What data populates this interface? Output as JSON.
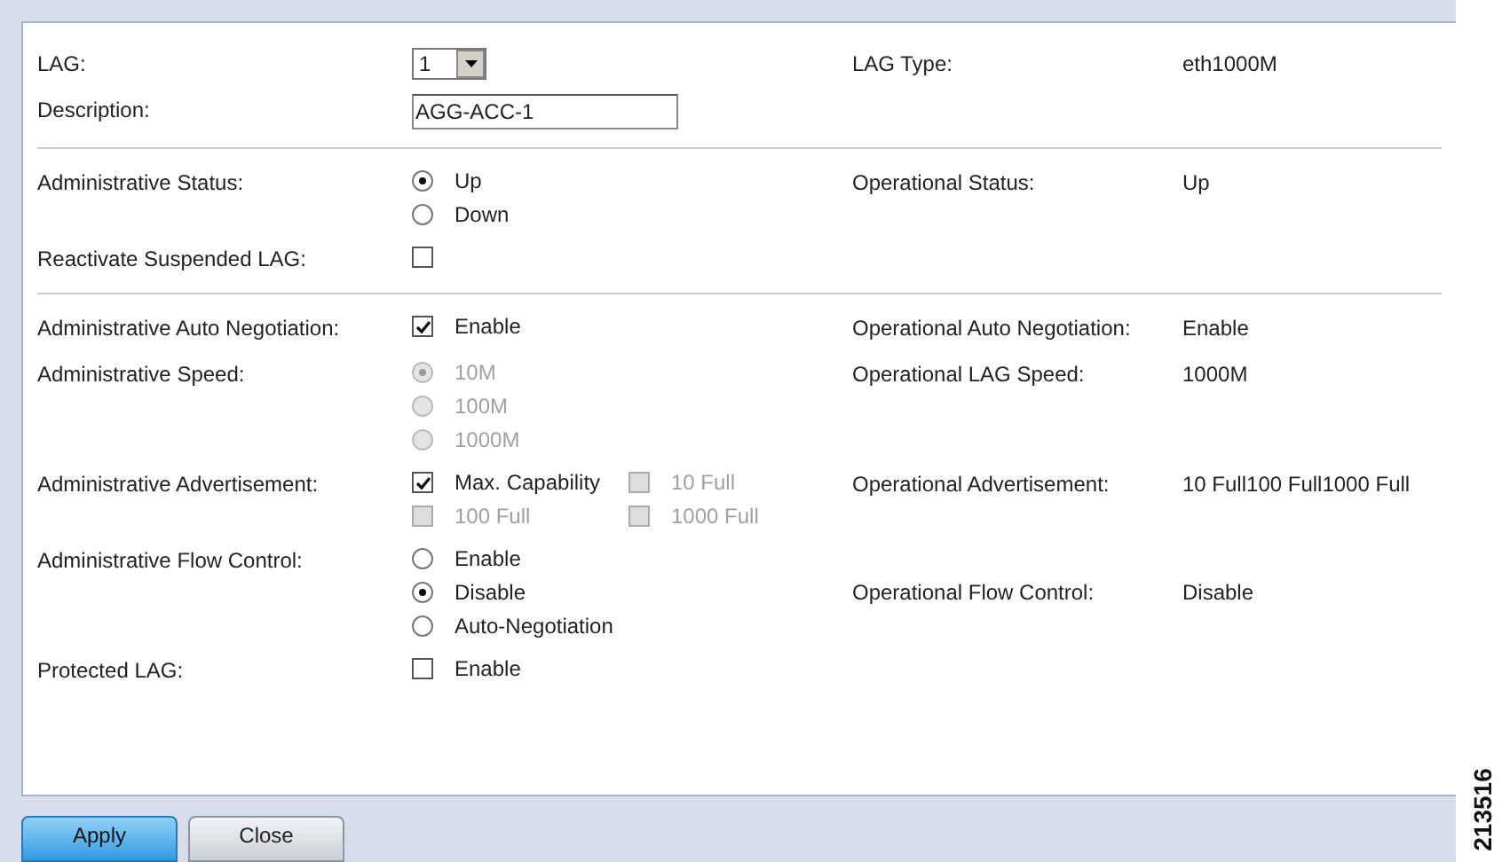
{
  "sections": [
    {
      "rows": [
        {
          "label": "LAG:",
          "control": {
            "kind": "select",
            "value": "1"
          },
          "op_label": "LAG Type:",
          "op_value": "eth1000M"
        },
        {
          "label": "Description:",
          "control": {
            "kind": "text",
            "value": "AGG-ACC-1"
          }
        }
      ]
    },
    {
      "rows": [
        {
          "label": "Administrative Status:",
          "control": {
            "kind": "radio",
            "options": [
              {
                "label": "Up",
                "selected": true,
                "disabled": false
              },
              {
                "label": "Down",
                "selected": false,
                "disabled": false
              }
            ]
          },
          "op_label": "Operational Status:",
          "op_value": "Up"
        },
        {
          "label": "Reactivate Suspended LAG:",
          "control": {
            "kind": "checkbox",
            "options": [
              {
                "checked": false,
                "disabled": false
              }
            ]
          }
        }
      ]
    },
    {
      "rows": [
        {
          "label": "Administrative Auto Negotiation:",
          "control": {
            "kind": "checkbox",
            "options": [
              {
                "label": "Enable",
                "checked": true,
                "disabled": false
              }
            ]
          },
          "op_label": "Operational Auto Negotiation:",
          "op_value": "Enable"
        },
        {
          "label": "Administrative Speed:",
          "control": {
            "kind": "radio",
            "options": [
              {
                "label": "10M",
                "selected": true,
                "disabled": true
              },
              {
                "label": "100M",
                "selected": false,
                "disabled": true
              },
              {
                "label": "1000M",
                "selected": false,
                "disabled": true
              }
            ]
          },
          "op_label": "Operational LAG Speed:",
          "op_value": "1000M"
        },
        {
          "label": "Administrative Advertisement:",
          "control": {
            "kind": "checkgrid",
            "options": [
              {
                "label": "Max. Capability",
                "checked": true,
                "disabled": false
              },
              {
                "label": "10 Full",
                "checked": false,
                "disabled": true
              },
              {
                "label": "100 Full",
                "checked": false,
                "disabled": true
              },
              {
                "label": "1000 Full",
                "checked": false,
                "disabled": true
              }
            ]
          },
          "op_label": "Operational Advertisement:",
          "op_value": "10 Full100 Full1000 Full"
        },
        {
          "label": "Administrative Flow Control:",
          "control": {
            "kind": "radio",
            "options": [
              {
                "label": "Enable",
                "selected": false,
                "disabled": false
              },
              {
                "label": "Disable",
                "selected": true,
                "disabled": false
              },
              {
                "label": "Auto-Negotiation",
                "selected": false,
                "disabled": false
              }
            ]
          },
          "op_label": "Operational Flow Control:",
          "op_value": "Disable"
        },
        {
          "label": "Protected LAG:",
          "control": {
            "kind": "checkbox",
            "options": [
              {
                "label": "Enable",
                "checked": false,
                "disabled": false
              }
            ]
          }
        }
      ]
    }
  ],
  "buttons": [
    {
      "label": "Apply",
      "kind": "primary"
    },
    {
      "label": "Close",
      "kind": "secondary"
    }
  ],
  "figure_number": "213516"
}
